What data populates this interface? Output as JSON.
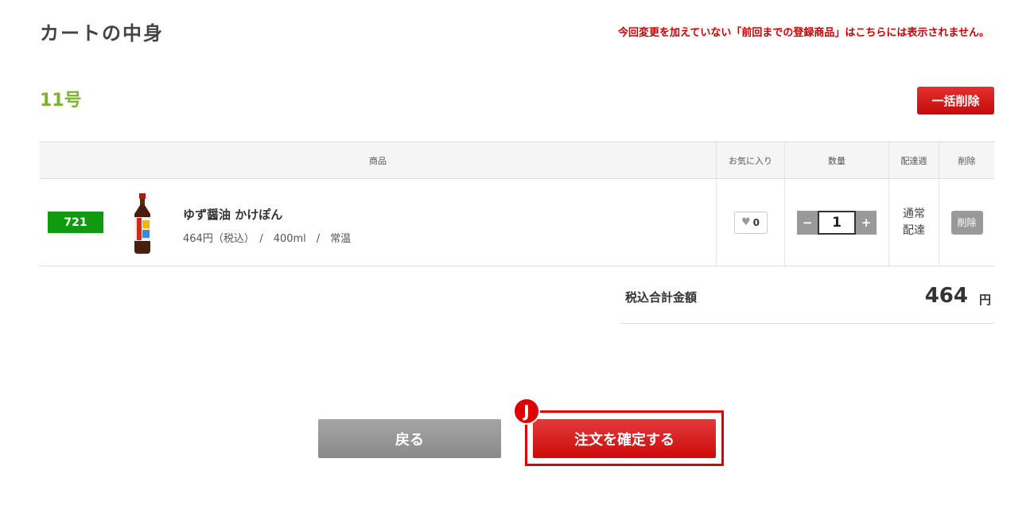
{
  "page": {
    "title": "カートの中身",
    "notice": "今回変更を加えていない「前回までの登録商品」はこちらには表示されません。"
  },
  "group": {
    "title": "11号",
    "bulk_delete_label": "一括削除"
  },
  "table": {
    "headers": {
      "product": "商品",
      "favorite": "お気に入り",
      "quantity": "数量",
      "shipping_week": "配達週",
      "delete": "削除"
    },
    "rows": [
      {
        "code": "721",
        "name": "ゆず醤油 かけぽん",
        "meta": "464円（税込）　/　400ml　/　常温",
        "favorite_count": "0",
        "quantity": "1",
        "shipping_line1": "通常",
        "shipping_line2": "配達",
        "delete_label": "削除"
      }
    ]
  },
  "stepper": {
    "minus": "−",
    "plus": "+"
  },
  "total": {
    "label": "税込合計金額",
    "value": "464",
    "unit": "円"
  },
  "actions": {
    "back_label": "戻る",
    "confirm_label": "注文を確定する",
    "step_marker": "J"
  },
  "icons": {
    "favorite": "heart-icon",
    "product_image": "soy-sauce-bottle"
  },
  "colors": {
    "accent_red": "#d11010",
    "group_green": "#7ab32e",
    "code_green": "#109a10",
    "gray_button": "#999999"
  }
}
